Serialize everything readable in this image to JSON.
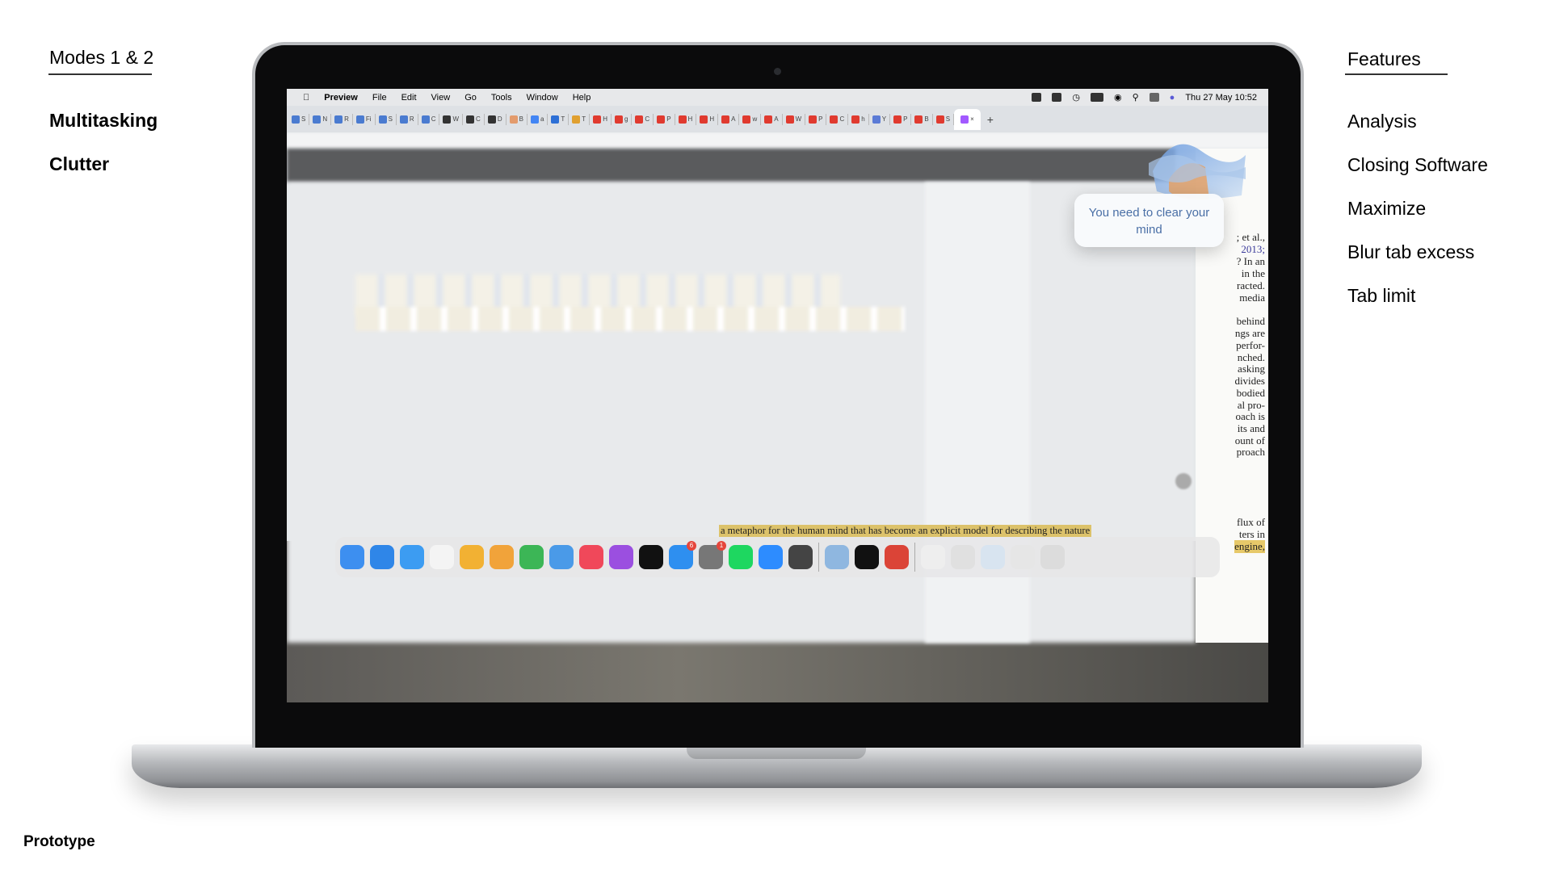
{
  "left": {
    "heading": "Modes 1 & 2",
    "items": [
      "Multitasking",
      "Clutter"
    ]
  },
  "right": {
    "heading": "Features",
    "items": [
      "Analysis",
      "Closing Software",
      "Maximize",
      "Blur tab excess",
      "Tab limit"
    ]
  },
  "footer": "Prototype",
  "menubar": {
    "app": "Preview",
    "items": [
      "File",
      "Edit",
      "View",
      "Go",
      "Tools",
      "Window",
      "Help"
    ],
    "clock": "Thu 27 May 10:52"
  },
  "tabs": [
    {
      "l": "S",
      "c": "#4a7bd0"
    },
    {
      "l": "N",
      "c": "#4a7bd0"
    },
    {
      "l": "R",
      "c": "#4a7bd0"
    },
    {
      "l": "Fi",
      "c": "#4a7bd0"
    },
    {
      "l": "S",
      "c": "#4a7bd0"
    },
    {
      "l": "R",
      "c": "#4a7bd0"
    },
    {
      "l": "C",
      "c": "#4a7bd0"
    },
    {
      "l": "W",
      "c": "#333"
    },
    {
      "l": "C",
      "c": "#333"
    },
    {
      "l": "D",
      "c": "#333"
    },
    {
      "l": "B",
      "c": "#e39b6d"
    },
    {
      "l": "a",
      "c": "#4285f4"
    },
    {
      "l": "T",
      "c": "#2d6fd6"
    },
    {
      "l": "T",
      "c": "#e0a030"
    },
    {
      "l": "H",
      "c": "#e03a2f"
    },
    {
      "l": "g",
      "c": "#e03a2f"
    },
    {
      "l": "C",
      "c": "#e03a2f"
    },
    {
      "l": "P",
      "c": "#e03a2f"
    },
    {
      "l": "H",
      "c": "#e03a2f"
    },
    {
      "l": "H",
      "c": "#e03a2f"
    },
    {
      "l": "A",
      "c": "#e03a2f"
    },
    {
      "l": "w",
      "c": "#e03a2f"
    },
    {
      "l": "A",
      "c": "#e03a2f"
    },
    {
      "l": "W",
      "c": "#e03a2f"
    },
    {
      "l": "P",
      "c": "#e03a2f"
    },
    {
      "l": "C",
      "c": "#e03a2f"
    },
    {
      "l": "h",
      "c": "#e03a2f"
    },
    {
      "l": "Y",
      "c": "#5b7bd6"
    },
    {
      "l": "P",
      "c": "#e03a2f"
    },
    {
      "l": "B",
      "c": "#e03a2f"
    },
    {
      "l": "S",
      "c": "#e03a2f"
    }
  ],
  "active_tab": {
    "l": "×",
    "c": "#a259ff"
  },
  "new_tab": "+",
  "paper_lines": [
    "; et al.,",
    "2013;",
    "? In an",
    "in the",
    "racted.",
    "media",
    "behind",
    "ngs are",
    "perfor-",
    "nched.",
    "asking",
    "divides",
    "bodied",
    "al pro-",
    "oach is",
    "its and",
    "ount of",
    "proach",
    "flux of",
    "ters in",
    "engine,"
  ],
  "metaphor_line": "a metaphor for the human mind that has become an explicit model for describing the nature",
  "bubble": "You need to clear your mind",
  "dock": [
    {
      "name": "finder",
      "c": "#3d8ff0"
    },
    {
      "name": "safari",
      "c": "#2f86e8"
    },
    {
      "name": "mail",
      "c": "#3c9cf2"
    },
    {
      "name": "reminders",
      "c": "#f4f4f4"
    },
    {
      "name": "photos",
      "c": "#f2b133"
    },
    {
      "name": "pages",
      "c": "#f1a33a"
    },
    {
      "name": "numbers",
      "c": "#3cb656"
    },
    {
      "name": "keynote",
      "c": "#4a9ae8"
    },
    {
      "name": "music",
      "c": "#f0485a"
    },
    {
      "name": "podcasts",
      "c": "#9b4fe0"
    },
    {
      "name": "apple-tv",
      "c": "#111"
    },
    {
      "name": "app-store",
      "c": "#2e8ff0",
      "badge": "6"
    },
    {
      "name": "system-preferences",
      "c": "#777",
      "badge": "1"
    },
    {
      "name": "spotify",
      "c": "#1ed760"
    },
    {
      "name": "zoom",
      "c": "#2d8cff"
    },
    {
      "name": "utility",
      "c": "#444"
    },
    {
      "sep": true
    },
    {
      "name": "preview",
      "c": "#8fb7e0"
    },
    {
      "name": "terminal",
      "c": "#111"
    },
    {
      "name": "chrome",
      "c": "#db4437"
    },
    {
      "sep": true
    },
    {
      "name": "document",
      "c": "#eee"
    },
    {
      "name": "chrome-window",
      "c": "#e0e0e0"
    },
    {
      "name": "keynote-window",
      "c": "#d8e4f0"
    },
    {
      "name": "finder-window",
      "c": "#e6e6e6"
    },
    {
      "name": "trash",
      "c": "#dcdcdc"
    }
  ]
}
